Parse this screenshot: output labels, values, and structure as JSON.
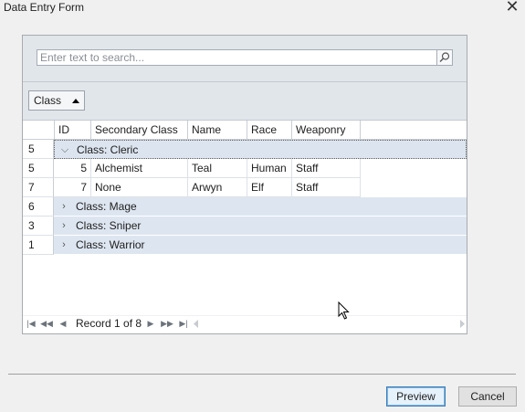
{
  "window": {
    "title": "Data Entry Form"
  },
  "search": {
    "placeholder": "Enter text to search..."
  },
  "grouping": {
    "chip_label": "Class"
  },
  "columns": [
    "ID",
    "Secondary Class",
    "Name",
    "Race",
    "Weaponry"
  ],
  "groups": [
    {
      "indicator": "5",
      "label": "Class: Cleric",
      "expanded": true,
      "rows": [
        {
          "indicator": "5",
          "id": "5",
          "secondary_class": "Alchemist",
          "name": "Teal",
          "race": "Human",
          "weaponry": "Staff"
        },
        {
          "indicator": "7",
          "id": "7",
          "secondary_class": "None",
          "name": "Arwyn",
          "race": "Elf",
          "weaponry": "Staff"
        }
      ]
    },
    {
      "indicator": "6",
      "label": "Class: Mage",
      "expanded": false
    },
    {
      "indicator": "3",
      "label": "Class: Sniper",
      "expanded": false
    },
    {
      "indicator": "1",
      "label": "Class: Warrior",
      "expanded": false
    }
  ],
  "pager": {
    "record_text": "Record 1 of 8"
  },
  "footer": {
    "preview_label": "Preview",
    "cancel_label": "Cancel"
  },
  "icons": {
    "close": "close-icon",
    "search": "search-icon",
    "sort": "sort-asc-icon",
    "collapse": "chevron-down-icon",
    "expand": "chevron-right-icon",
    "pager": [
      "first-page-icon",
      "prev-page-icon",
      "prev-record-icon",
      "next-record-icon",
      "next-page-icon",
      "last-page-icon"
    ]
  },
  "colors": {
    "group_row_bg": "#dde6f0",
    "panel_bg": "#e1e6eb",
    "accent_border": "#3c7fb1"
  }
}
